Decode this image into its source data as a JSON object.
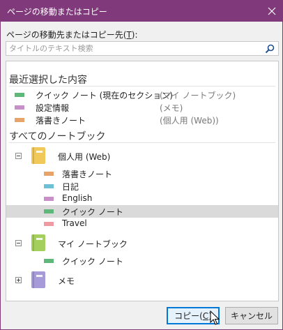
{
  "dialog": {
    "title": "ページの移動またはコピー",
    "close_icon": "close-icon",
    "destination_label_prefix": "ページの移動先またはコピー先(",
    "destination_label_key": "T",
    "destination_label_suffix": "):",
    "search": {
      "value": "",
      "placeholder": "タイトルのテキスト検索",
      "icon": "search-icon"
    }
  },
  "recent": {
    "heading": "最近選択した内容",
    "items": [
      {
        "name": "クイック ノート (現在のセクション)",
        "notebook": "(マイ ノートブック)",
        "color": "#5fb779"
      },
      {
        "name": "設定情報",
        "notebook": "(メモ)",
        "color": "#c98fc9"
      },
      {
        "name": "落書きノート",
        "notebook": "(個人用 (Web))",
        "color": "#e6a46a"
      }
    ]
  },
  "all": {
    "heading": "すべてのノートブック",
    "notebooks": [
      {
        "name": "個人用 (Web)",
        "expanded": true,
        "color": "#f0c95a",
        "sections": [
          {
            "name": "落書きノート",
            "color": "#e6a46a"
          },
          {
            "name": "日記",
            "color": "#6ec0d4"
          },
          {
            "name": "English",
            "color": "#c98fc9"
          },
          {
            "name": "クイック ノート",
            "color": "#5fb779",
            "selected": true
          },
          {
            "name": "Travel",
            "color": "#ef9aa3"
          }
        ]
      },
      {
        "name": "マイ ノートブック",
        "expanded": true,
        "color": "#a4cf5c",
        "sections": [
          {
            "name": "クイック ノート",
            "color": "#5fb779"
          }
        ]
      },
      {
        "name": "メモ",
        "expanded": false,
        "color": "#a79ad8",
        "sections": []
      }
    ]
  },
  "buttons": {
    "copy_prefix": "コピー(",
    "copy_key": "C",
    "copy_suffix": ")",
    "cancel": "キャンセル"
  }
}
